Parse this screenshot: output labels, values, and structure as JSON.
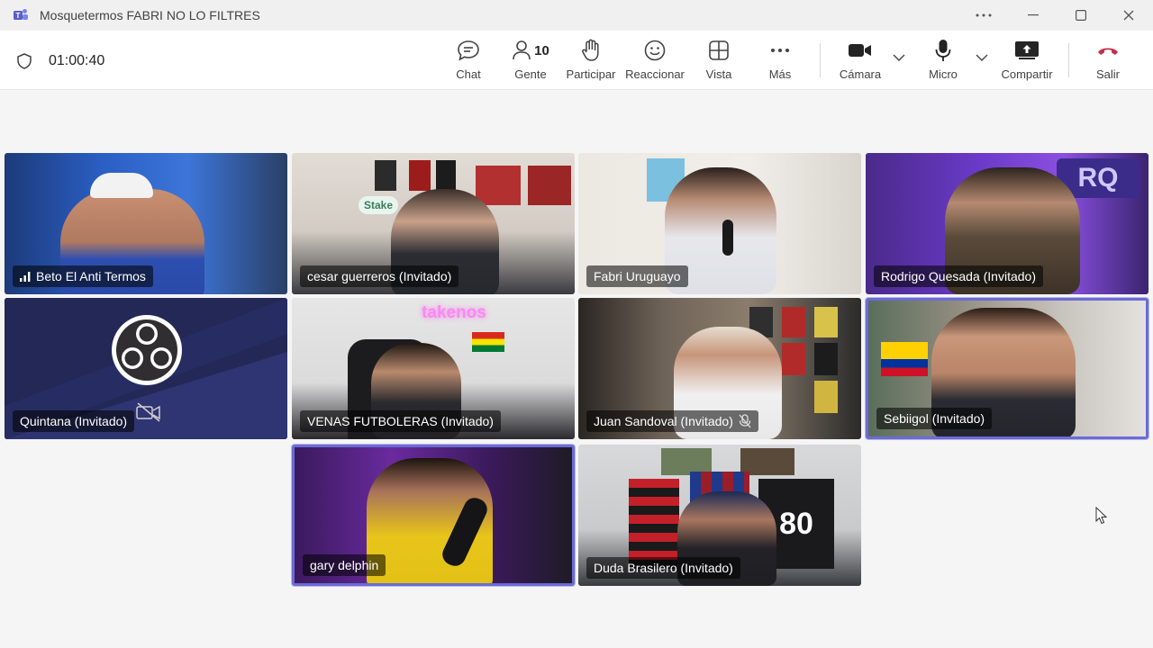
{
  "window": {
    "title": "Mosquetermos FABRI NO LO FILTRES"
  },
  "meeting": {
    "timer": "01:00:40"
  },
  "toolbar": {
    "chat_label": "Chat",
    "people_label": "Gente",
    "people_count": "10",
    "raise_hand_label": "Participar",
    "react_label": "Reaccionar",
    "view_label": "Vista",
    "more_label": "Más",
    "camera_label": "Cámara",
    "mic_label": "Micro",
    "share_label": "Compartir",
    "leave_label": "Salir"
  },
  "participants": [
    {
      "name": "Beto El Anti Termos"
    },
    {
      "name": "cesar guerreros (Invitado)"
    },
    {
      "name": "Fabri Uruguayo"
    },
    {
      "name": "Rodrigo Quesada (Invitado)"
    },
    {
      "name": "Quintana (Invitado)"
    },
    {
      "name": "VENAS FUTBOLERAS (Invitado)"
    },
    {
      "name": "Juan Sandoval (Invitado)"
    },
    {
      "name": "Sebiigol (Invitado)"
    },
    {
      "name": "gary delphin"
    },
    {
      "name": "Duda Brasilero (Invitado)"
    }
  ],
  "tile_text": {
    "neon_sign": "takenos",
    "stake_sign": "Stake"
  },
  "colors": {
    "accent": "#6b6bd6",
    "leave": "#c4314b",
    "obs_tile": "#252a5a"
  },
  "icons": {
    "signal": "signal-bars-icon",
    "camera_off": "camera-off-icon",
    "mic_off": "mic-off-icon"
  }
}
